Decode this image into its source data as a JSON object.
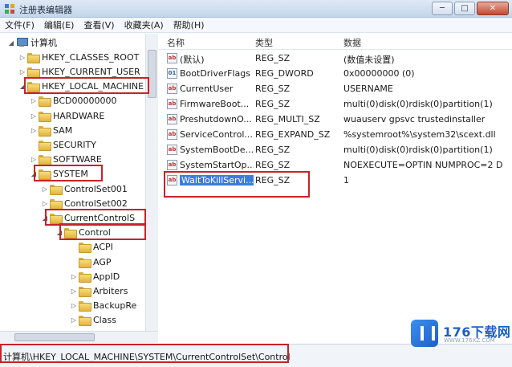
{
  "window": {
    "title": "注册表编辑器",
    "btn_min": "─",
    "btn_max": "□",
    "btn_close": "✕"
  },
  "menu": [
    "文件(F)",
    "编辑(E)",
    "查看(V)",
    "收藏夹(A)",
    "帮助(H)"
  ],
  "tree": [
    {
      "label": "计算机",
      "arrow": "◢",
      "icon": "computer"
    },
    {
      "label": "HKEY_CLASSES_ROOT",
      "arrow": "▷",
      "icon": "folder"
    },
    {
      "label": "HKEY_CURRENT_USER",
      "arrow": "▷",
      "icon": "folder"
    },
    {
      "label": "HKEY_LOCAL_MACHINE",
      "arrow": "◢",
      "icon": "folder"
    },
    {
      "label": "BCD00000000",
      "arrow": "▷",
      "icon": "folder"
    },
    {
      "label": "HARDWARE",
      "arrow": "▷",
      "icon": "folder"
    },
    {
      "label": "SAM",
      "arrow": "▷",
      "icon": "folder"
    },
    {
      "label": "SECURITY",
      "arrow": "",
      "icon": "folder"
    },
    {
      "label": "SOFTWARE",
      "arrow": "▷",
      "icon": "folder"
    },
    {
      "label": "SYSTEM",
      "arrow": "◢",
      "icon": "folder"
    },
    {
      "label": "ControlSet001",
      "arrow": "▷",
      "icon": "folder"
    },
    {
      "label": "ControlSet002",
      "arrow": "▷",
      "icon": "folder"
    },
    {
      "label": "CurrentControlS",
      "arrow": "◢",
      "icon": "folder"
    },
    {
      "label": "Control",
      "arrow": "◢",
      "icon": "folder"
    },
    {
      "label": "ACPI",
      "arrow": "",
      "icon": "folder"
    },
    {
      "label": "AGP",
      "arrow": "",
      "icon": "folder"
    },
    {
      "label": "AppID",
      "arrow": "▷",
      "icon": "folder"
    },
    {
      "label": "Arbiters",
      "arrow": "▷",
      "icon": "folder"
    },
    {
      "label": "BackupRe",
      "arrow": "▷",
      "icon": "folder"
    },
    {
      "label": "Class",
      "arrow": "▷",
      "icon": "folder"
    }
  ],
  "list": {
    "headers": {
      "name": "名称",
      "type": "类型",
      "data": "数据"
    },
    "rows": [
      {
        "icon": "ab",
        "name": "(默认)",
        "type": "REG_SZ",
        "data": "(数值未设置)"
      },
      {
        "icon": "bin",
        "name": "BootDriverFlags",
        "type": "REG_DWORD",
        "data": "0x00000000 (0)"
      },
      {
        "icon": "ab",
        "name": "CurrentUser",
        "type": "REG_SZ",
        "data": "USERNAME"
      },
      {
        "icon": "ab",
        "name": "FirmwareBoot...",
        "type": "REG_SZ",
        "data": "multi(0)disk(0)rdisk(0)partition(1)"
      },
      {
        "icon": "ab",
        "name": "PreshutdownO...",
        "type": "REG_MULTI_SZ",
        "data": "wuauserv gpsvc trustedinstaller"
      },
      {
        "icon": "ab",
        "name": "ServiceControl...",
        "type": "REG_EXPAND_SZ",
        "data": "%systemroot%\\system32\\scext.dll"
      },
      {
        "icon": "ab",
        "name": "SystemBootDe...",
        "type": "REG_SZ",
        "data": "multi(0)disk(0)rdisk(0)partition(1)"
      },
      {
        "icon": "ab",
        "name": "SystemStartOp...",
        "type": "REG_SZ",
        "data": "NOEXECUTE=OPTIN  NUMPROC=2 D"
      },
      {
        "icon": "ab",
        "name": "WaitToKillServi...",
        "type": "REG_SZ",
        "data": "1",
        "selected": true
      }
    ]
  },
  "status": "计算机\\HKEY_LOCAL_MACHINE\\SYSTEM\\CurrentControlSet\\Control",
  "watermark": {
    "name": "176下载网",
    "url": "WWW.176XZ.COM"
  }
}
